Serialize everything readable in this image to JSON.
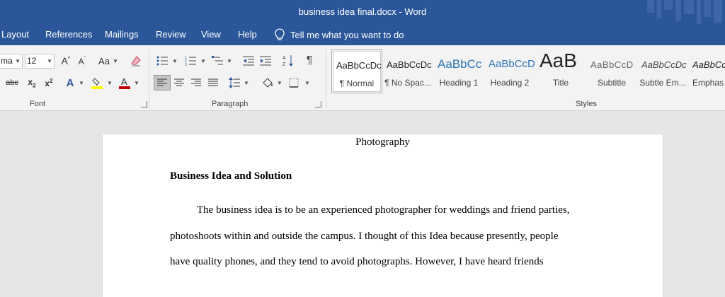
{
  "window": {
    "title": "business idea final.docx  -  Word"
  },
  "tabs": [
    {
      "label": "Layout"
    },
    {
      "label": "References"
    },
    {
      "label": "Mailings"
    },
    {
      "label": "Review"
    },
    {
      "label": "View"
    },
    {
      "label": "Help"
    }
  ],
  "tell_me": {
    "text": "Tell me what you want to do"
  },
  "font_group": {
    "font_name": "ma",
    "font_size": "12",
    "label": "Font",
    "change_case": "Aa",
    "strikethrough": "abc"
  },
  "paragraph_group": {
    "label": "Paragraph"
  },
  "styles_group": {
    "label": "Styles",
    "items": [
      {
        "sample": "AaBbCcDc",
        "name": "¶ Normal"
      },
      {
        "sample": "AaBbCcDc",
        "name": "¶ No Spac..."
      },
      {
        "sample": "AaBbCc",
        "name": "Heading 1"
      },
      {
        "sample": "AaBbCcD",
        "name": "Heading 2"
      },
      {
        "sample": "AaB",
        "name": "Title"
      },
      {
        "sample": "AaBbCcD",
        "name": "Subtitle"
      },
      {
        "sample": "AaBbCcDc",
        "name": "Subtle Em..."
      },
      {
        "sample": "AaBbCc",
        "name": "Emphas"
      }
    ]
  },
  "document": {
    "header": "Photography",
    "heading": "Business Idea and Solution",
    "paragraph_lines": [
      "The business idea is to be an experienced photographer for weddings and friend parties,",
      "photoshoots within and outside the campus. I thought of this Idea because presently, people",
      "have quality phones, and they tend to avoid photographs. However, I have heard friends"
    ]
  },
  "colors": {
    "title_bar": "#2b579a",
    "ribbon_bg": "#f3f3f3",
    "canvas_bg": "#e6e6e6",
    "highlight": "#ffff00",
    "font_color": "#c00000"
  }
}
